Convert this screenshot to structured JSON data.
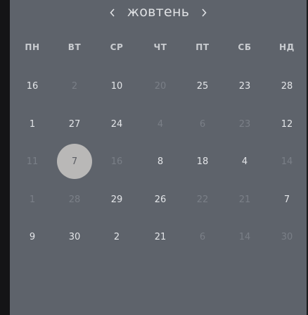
{
  "calendar": {
    "month_label": "жовтень",
    "prev_icon": "chevron-left-icon",
    "next_icon": "chevron-right-icon",
    "weekdays": [
      "ПН",
      "ВТ",
      "СР",
      "ЧТ",
      "ПТ",
      "СБ",
      "НД"
    ],
    "weeks": [
      [
        {
          "t": "16",
          "dim": false
        },
        {
          "t": "2",
          "dim": true
        },
        {
          "t": "10",
          "dim": false
        },
        {
          "t": "20",
          "dim": true
        },
        {
          "t": "25",
          "dim": false
        },
        {
          "t": "23",
          "dim": false
        },
        {
          "t": "28",
          "dim": false
        }
      ],
      [
        {
          "t": "1",
          "dim": false
        },
        {
          "t": "27",
          "dim": false
        },
        {
          "t": "24",
          "dim": false
        },
        {
          "t": "4",
          "dim": true
        },
        {
          "t": "6",
          "dim": true
        },
        {
          "t": "23",
          "dim": true
        },
        {
          "t": "12",
          "dim": false
        }
      ],
      [
        {
          "t": "11",
          "dim": true
        },
        {
          "t": "7",
          "dim": false,
          "selected": true
        },
        {
          "t": "16",
          "dim": true
        },
        {
          "t": "8",
          "dim": false
        },
        {
          "t": "18",
          "dim": false
        },
        {
          "t": "4",
          "dim": false
        },
        {
          "t": "14",
          "dim": true
        }
      ],
      [
        {
          "t": "1",
          "dim": true
        },
        {
          "t": "28",
          "dim": true
        },
        {
          "t": "29",
          "dim": false
        },
        {
          "t": "26",
          "dim": false
        },
        {
          "t": "22",
          "dim": true
        },
        {
          "t": "21",
          "dim": true
        },
        {
          "t": "7",
          "dim": false
        }
      ],
      [
        {
          "t": "9",
          "dim": false
        },
        {
          "t": "30",
          "dim": false
        },
        {
          "t": "2",
          "dim": false
        },
        {
          "t": "21",
          "dim": false
        },
        {
          "t": "6",
          "dim": true
        },
        {
          "t": "14",
          "dim": true
        },
        {
          "t": "30",
          "dim": true
        }
      ]
    ]
  },
  "colors": {
    "panel": "#5e636b",
    "text": "#e3e5e8",
    "dim_text": "#7a7f87",
    "selected_bg": "#b9b8b7"
  }
}
